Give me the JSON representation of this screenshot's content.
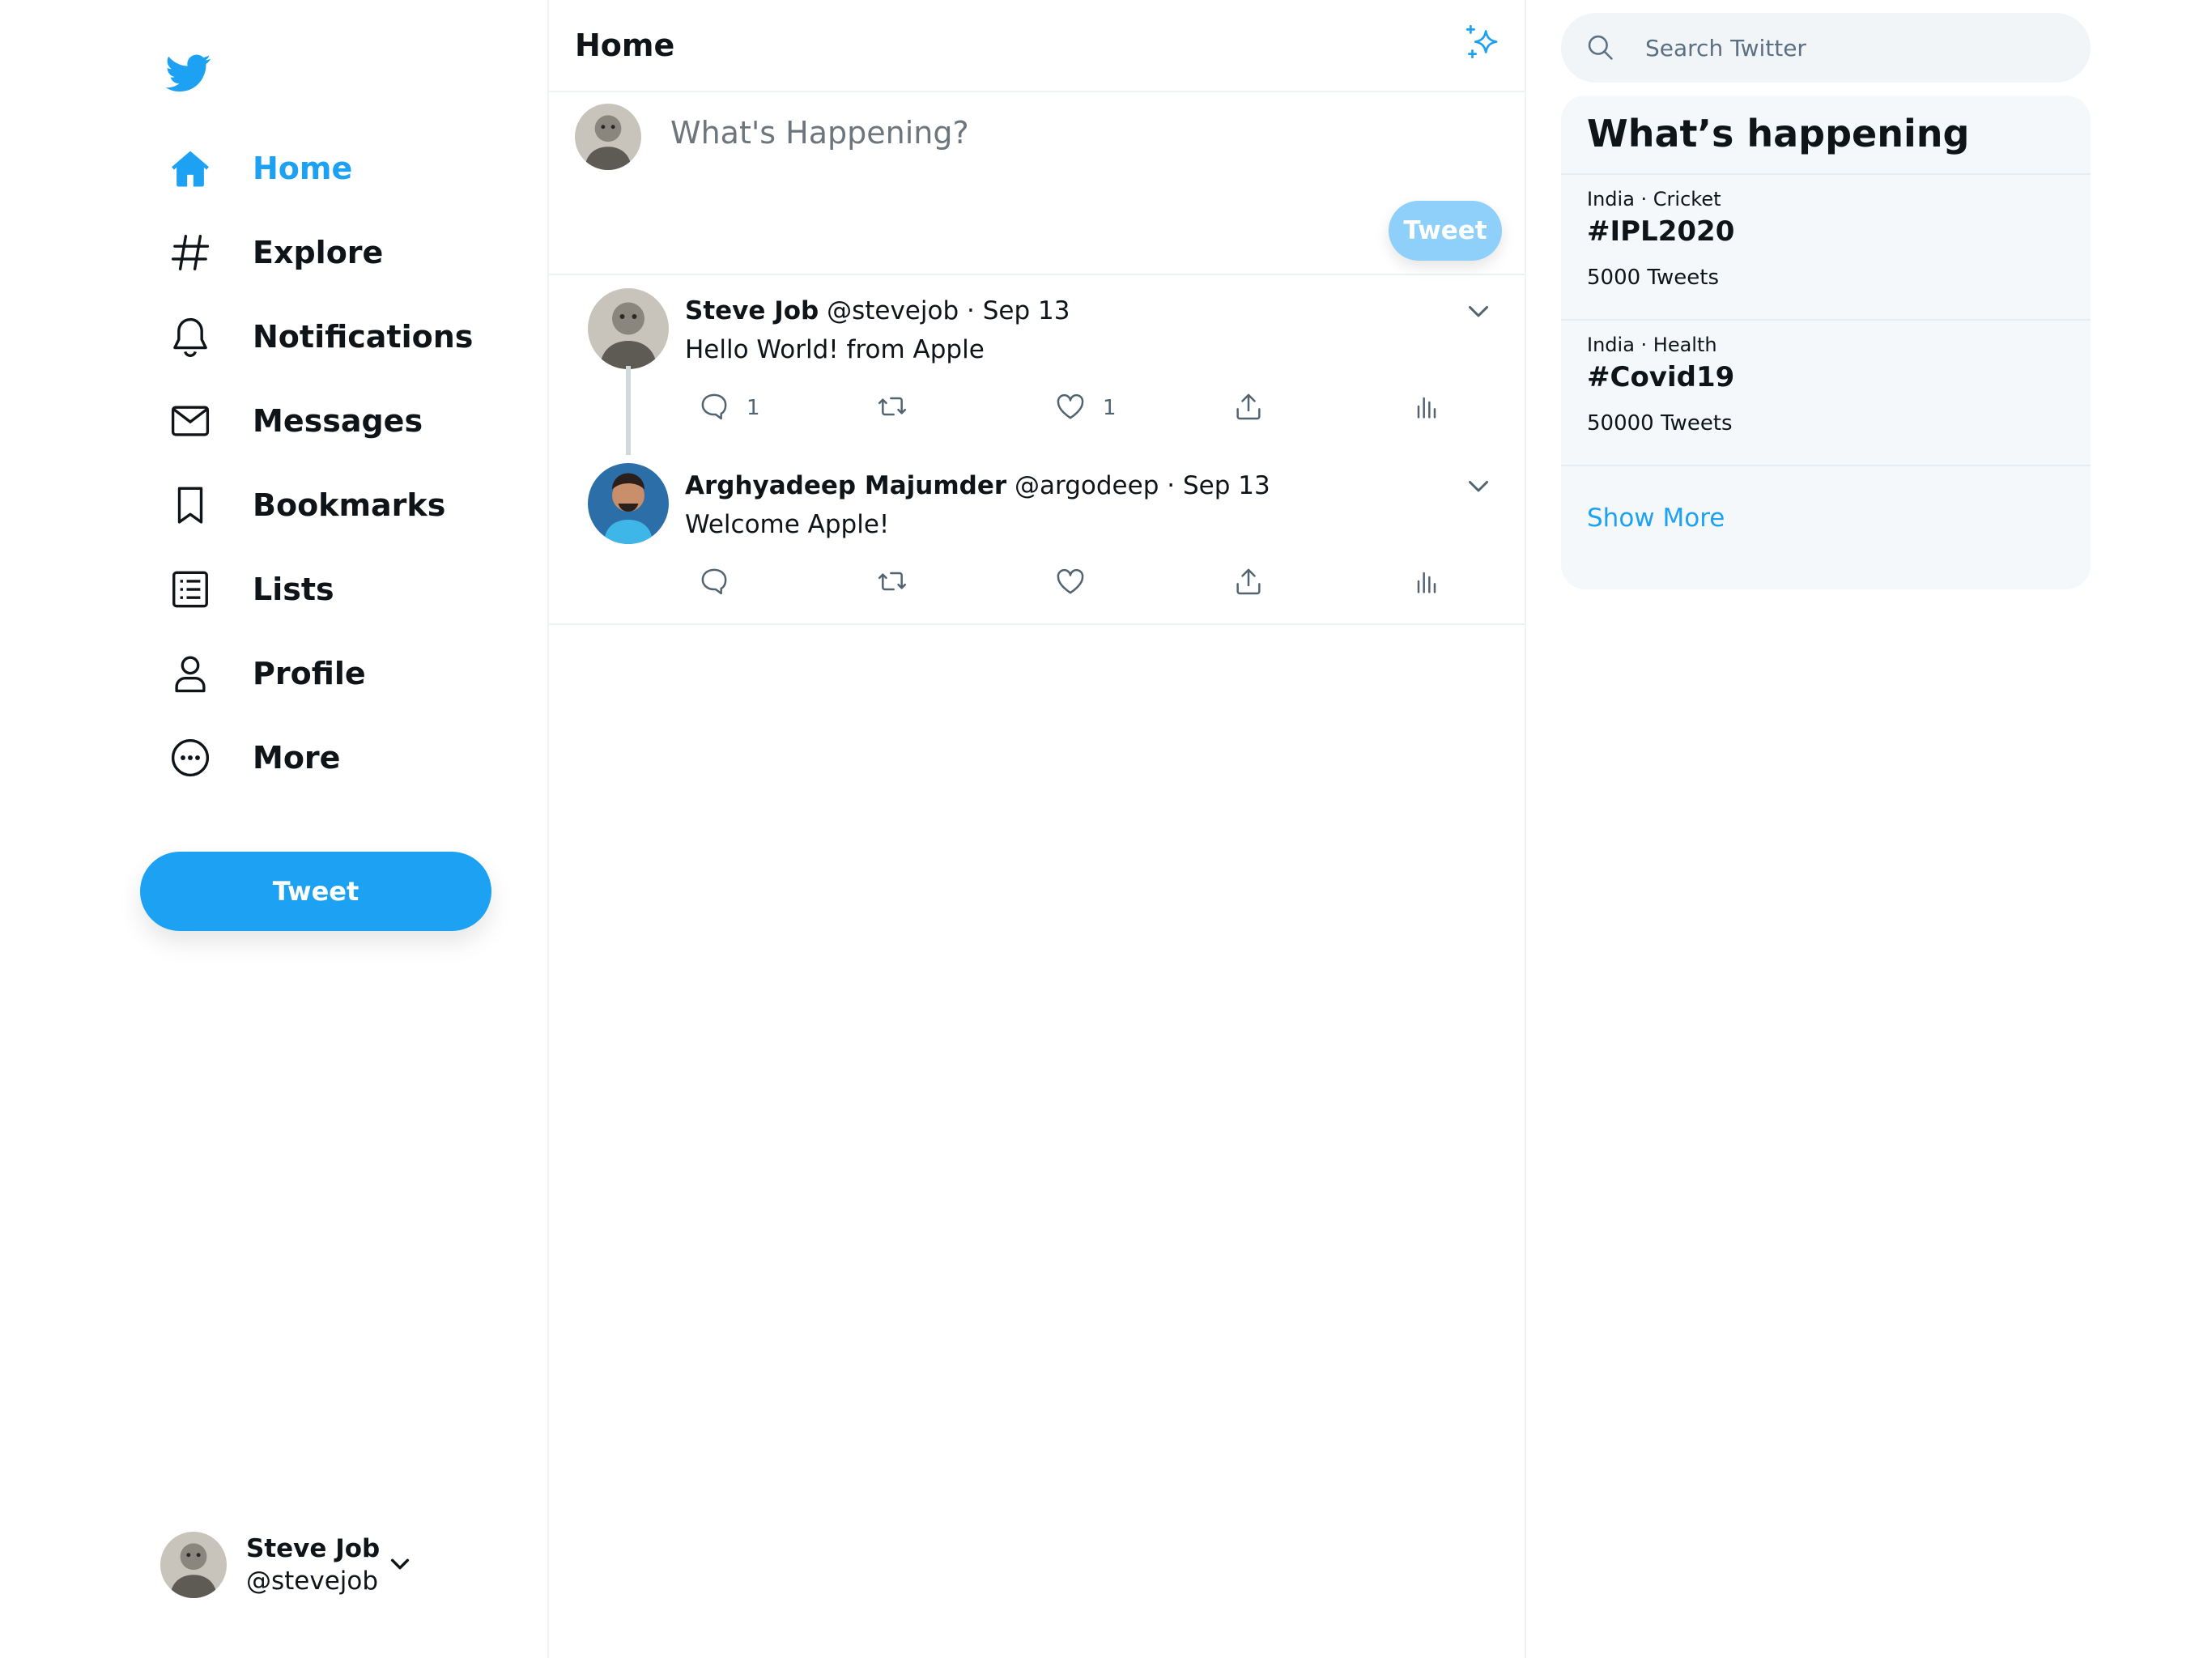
{
  "colors": {
    "accent": "#1da1f2",
    "accent_light": "#8ed0f9",
    "text": "#0f1419",
    "muted": "#6e767d",
    "panel_bg": "#f5f8fa"
  },
  "sidebar": {
    "logo_icon": "twitter-bird-icon",
    "items": [
      {
        "label": "Home",
        "icon": "home-icon",
        "active": true
      },
      {
        "label": "Explore",
        "icon": "hashtag-icon"
      },
      {
        "label": "Notifications",
        "icon": "bell-icon"
      },
      {
        "label": "Messages",
        "icon": "envelope-icon"
      },
      {
        "label": "Bookmarks",
        "icon": "bookmark-icon"
      },
      {
        "label": "Lists",
        "icon": "list-icon"
      },
      {
        "label": "Profile",
        "icon": "person-icon"
      },
      {
        "label": "More",
        "icon": "more-circle-icon"
      }
    ],
    "tweet_button": "Tweet",
    "account": {
      "name": "Steve Job",
      "handle": "@stevejob"
    }
  },
  "feed": {
    "title": "Home",
    "composer": {
      "placeholder": "What's Happening?",
      "button": "Tweet"
    },
    "tweets": [
      {
        "name": "Steve Job",
        "handle": "@stevejob",
        "sep": "·",
        "date": "Sep 13",
        "text": "Hello World! from Apple",
        "replies": "1",
        "likes": "1"
      },
      {
        "name": "Arghyadeep Majumder",
        "handle": "@argodeep",
        "sep": "·",
        "date": "Sep 13",
        "text": "Welcome Apple!",
        "replies": "",
        "likes": ""
      }
    ]
  },
  "right": {
    "search_placeholder": "Search Twitter",
    "trends_title": "What’s happening",
    "trends": [
      {
        "category": "India · Cricket",
        "tag": "#IPL2020",
        "count": "5000 Tweets"
      },
      {
        "category": "India · Health",
        "tag": "#Covid19",
        "count": "50000 Tweets"
      }
    ],
    "show_more": "Show More"
  }
}
